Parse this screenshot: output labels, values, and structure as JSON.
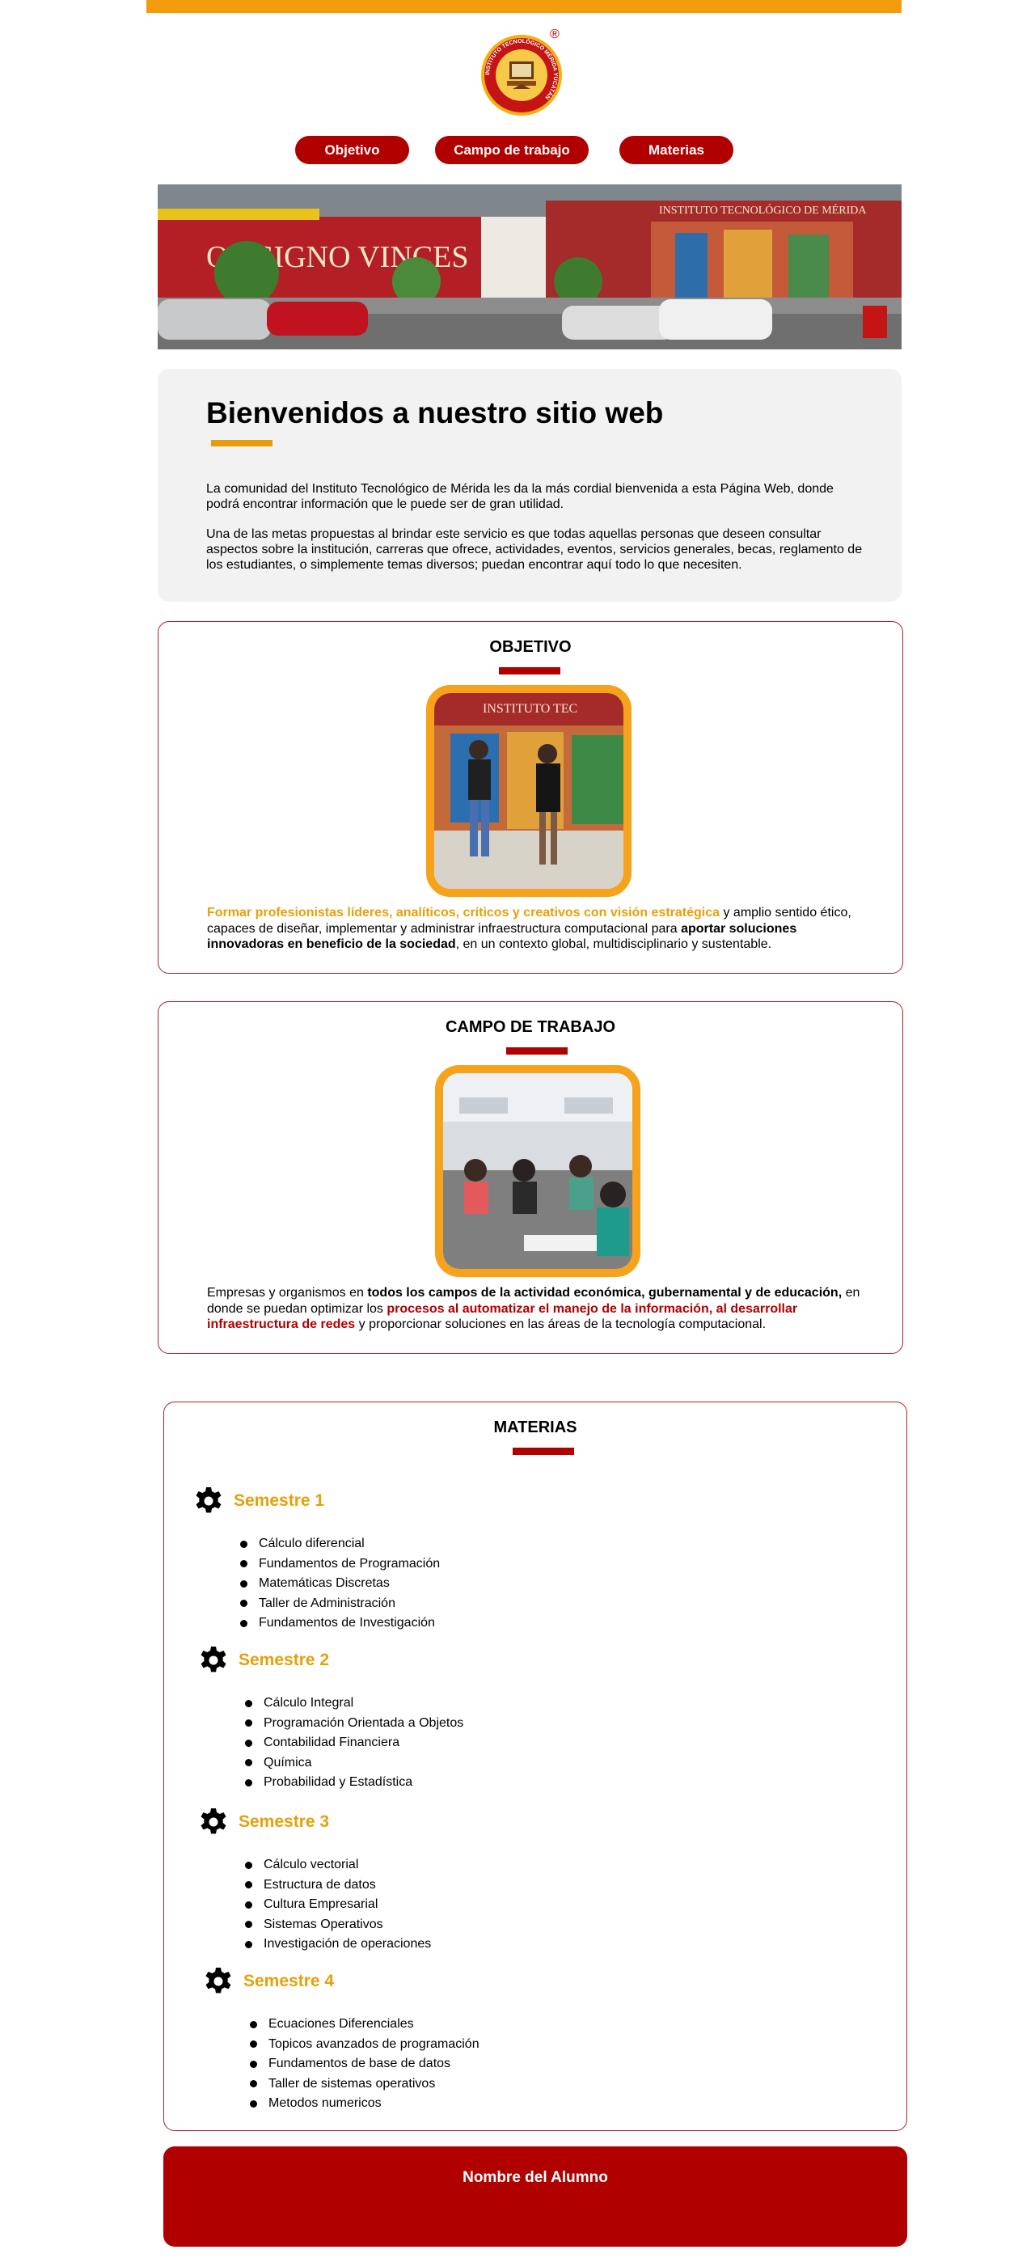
{
  "nav": {
    "items": [
      {
        "label": "Objetivo"
      },
      {
        "label": "Campo de trabajo"
      },
      {
        "label": "Materias"
      }
    ]
  },
  "logo": {
    "registered_mark": "®",
    "ring_text": "INSTITUTO TECNOLÓGICO MÉRIDA YUCATÁN"
  },
  "hero": {
    "sign_text": "OC SIGNO VINCES",
    "building_text": "INSTITUTO TECNOLÓGICO DE MÉRIDA"
  },
  "welcome": {
    "title": "Bienvenidos a nuestro sitio web",
    "p1": "La comunidad del Instituto Tecnológico de Mérida les da la más cordial bienvenida a esta Página Web, donde podrá encontrar información que le puede ser de gran utilidad.",
    "p2": "Una de las metas propuestas al brindar este servicio es que todas aquellas personas que deseen consultar aspectos sobre la institución, carreras que ofrece, actividades, eventos, servicios generales, becas, reglamento de los estudiantes, o simplemente temas diversos; puedan encontrar aquí todo lo que necesiten."
  },
  "objetivo": {
    "title": "OBJETIVO",
    "photo_sign": "INSTITUTO TEC",
    "t1": "Formar profesionistas líderes, analíticos, críticos y creativos con visión estratégica",
    "t2": " y amplio sentido ético, capaces de diseñar, implementar y administrar infraestructura computacional para ",
    "t3": "aportar soluciones innovadoras en beneficio de la sociedad",
    "t4": ", en un contexto global, multidisciplinario y sustentable."
  },
  "campo": {
    "title": "CAMPO DE TRABAJO",
    "t1": "Empresas y organismos en ",
    "t2": "todos los campos de la actividad económica, gubernamental y de educación,",
    "t3": " en donde se puedan optimizar los ",
    "t4": "procesos al automatizar el manejo de la información, al desarrollar infraestructura de redes",
    "t5": " y proporcionar soluciones en las áreas de la tecnología computacional."
  },
  "materias": {
    "title": "MATERIAS",
    "semesters": [
      {
        "label": "Semestre 1",
        "items": [
          "Cálculo diferencial",
          "Fundamentos de Programación",
          "Matemáticas Discretas",
          "Taller de Administración",
          "Fundamentos de Investigación"
        ]
      },
      {
        "label": "Semestre 2",
        "items": [
          "Cálculo Integral",
          "Programación Orientada a Objetos",
          "Contabilidad Financiera",
          "Química",
          "Probabilidad y Estadística"
        ]
      },
      {
        "label": "Semestre 3",
        "items": [
          "Cálculo vectorial",
          "Estructura de datos",
          "Cultura Empresarial",
          "Sistemas Operativos",
          "Investigación de operaciones"
        ]
      },
      {
        "label": "Semestre 4",
        "items": [
          "Ecuaciones Diferenciales",
          "Topicos avanzados de programación",
          "Fundamentos de base de datos",
          "Taller de sistemas operativos",
          "Metodos numericos"
        ]
      }
    ]
  },
  "footer": {
    "label": "Nombre del Alumno"
  },
  "colors": {
    "accent_orange": "#f29c0d",
    "brand_red": "#b00000",
    "panel_grey": "#f2f2f2"
  },
  "icons": [
    "gear-icon"
  ]
}
